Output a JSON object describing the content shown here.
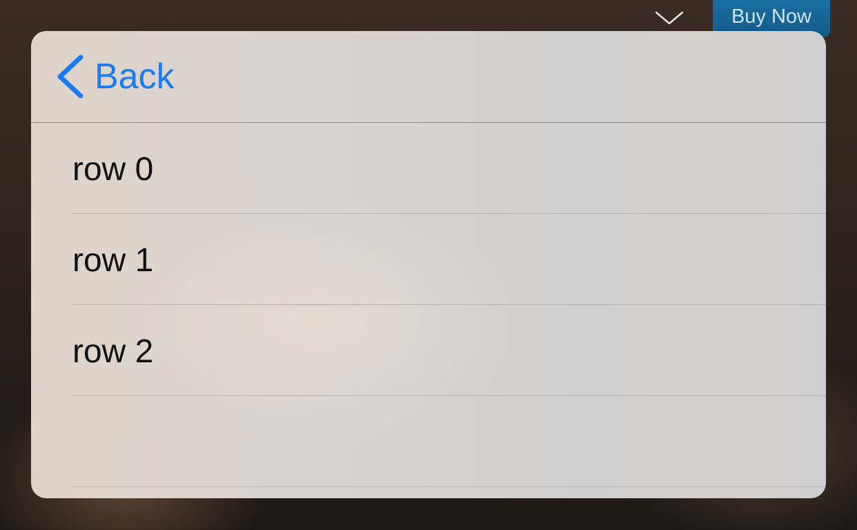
{
  "topbar": {
    "chevron_icon": "chevron-down-icon",
    "buy_label": "Buy Now",
    "buy_color": "#1b6fa3"
  },
  "popover": {
    "back_label": "Back",
    "back_icon": "chevron-left-icon",
    "accent_color": "#1a7cf5",
    "rows": [
      {
        "label": "row 0"
      },
      {
        "label": "row 1"
      },
      {
        "label": "row 2"
      },
      {
        "label": ""
      }
    ]
  }
}
